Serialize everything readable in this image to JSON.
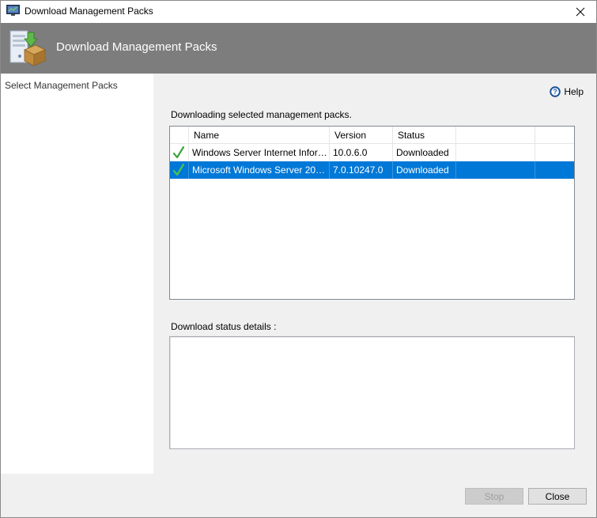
{
  "window": {
    "title": "Download Management Packs"
  },
  "banner": {
    "title": "Download Management Packs"
  },
  "sidebar": {
    "steps": [
      {
        "label": "Select Management Packs"
      }
    ]
  },
  "content": {
    "help_label": "Help",
    "intro": "Downloading selected management packs.",
    "columns": [
      "Name",
      "Version",
      "Status"
    ],
    "rows": [
      {
        "name": "Windows Server Internet Informati...",
        "version": "10.0.6.0",
        "status": "Downloaded",
        "selected": false
      },
      {
        "name": "Microsoft Windows Server 2012 In...",
        "version": "7.0.10247.0",
        "status": "Downloaded",
        "selected": true
      }
    ],
    "details_label": "Download status details :"
  },
  "footer": {
    "stop_label": "Stop",
    "close_label": "Close"
  },
  "icons": {
    "check": "green-checkmark-icon",
    "help": "help-circle-icon",
    "close": "close-x-icon"
  },
  "colors": {
    "banner": "#7d7d7d",
    "selection": "#0078d7",
    "check": "#3aa43a"
  }
}
